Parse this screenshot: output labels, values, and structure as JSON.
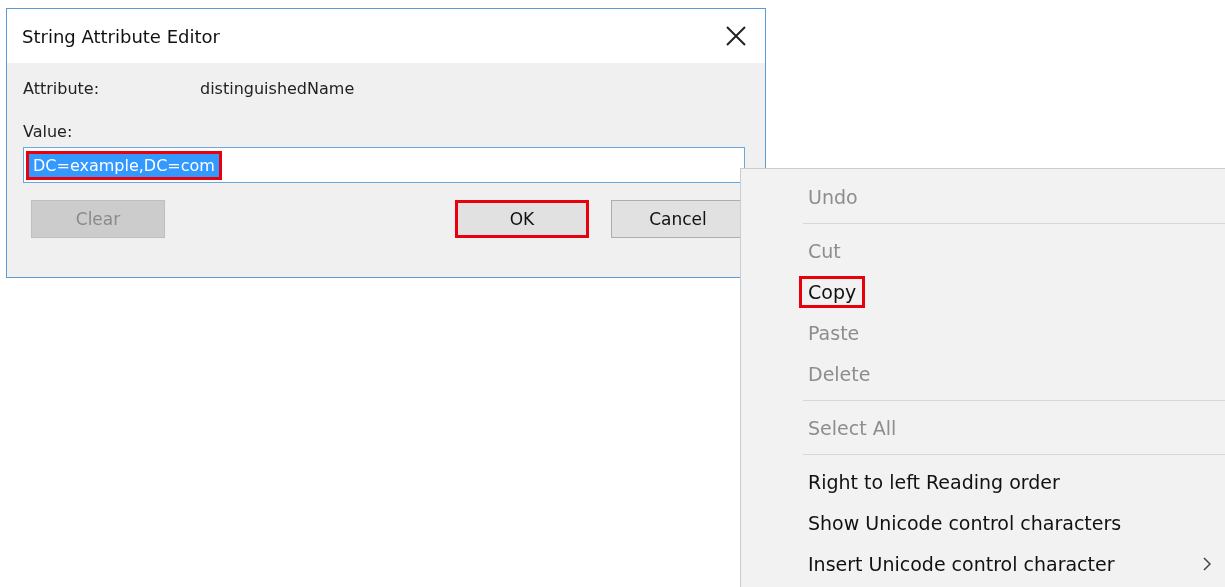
{
  "dialog": {
    "title": "String Attribute Editor",
    "attribute_label": "Attribute:",
    "attribute_value": "distinguishedName",
    "value_label": "Value:",
    "value": "DC=example,DC=com",
    "value_selected": true,
    "value_highlighted": true,
    "buttons": [
      {
        "label": "Clear",
        "disabled": true,
        "highlighted": false
      },
      {
        "label": "OK",
        "disabled": false,
        "highlighted": true
      },
      {
        "label": "Cancel",
        "disabled": false,
        "highlighted": false
      }
    ]
  },
  "context_menu": {
    "items": [
      {
        "kind": "item",
        "label": "Undo",
        "disabled": true,
        "highlighted": false,
        "submenu": false
      },
      {
        "kind": "separator"
      },
      {
        "kind": "item",
        "label": "Cut",
        "disabled": true,
        "highlighted": false,
        "submenu": false
      },
      {
        "kind": "item",
        "label": "Copy",
        "disabled": false,
        "highlighted": true,
        "submenu": false
      },
      {
        "kind": "item",
        "label": "Paste",
        "disabled": true,
        "highlighted": false,
        "submenu": false
      },
      {
        "kind": "item",
        "label": "Delete",
        "disabled": true,
        "highlighted": false,
        "submenu": false
      },
      {
        "kind": "separator"
      },
      {
        "kind": "item",
        "label": "Select All",
        "disabled": true,
        "highlighted": false,
        "submenu": false
      },
      {
        "kind": "separator"
      },
      {
        "kind": "item",
        "label": "Right to left Reading order",
        "disabled": false,
        "highlighted": false,
        "submenu": false
      },
      {
        "kind": "item",
        "label": "Show Unicode control characters",
        "disabled": false,
        "highlighted": false,
        "submenu": false
      },
      {
        "kind": "item",
        "label": "Insert Unicode control character",
        "disabled": false,
        "highlighted": false,
        "submenu": true
      }
    ]
  }
}
